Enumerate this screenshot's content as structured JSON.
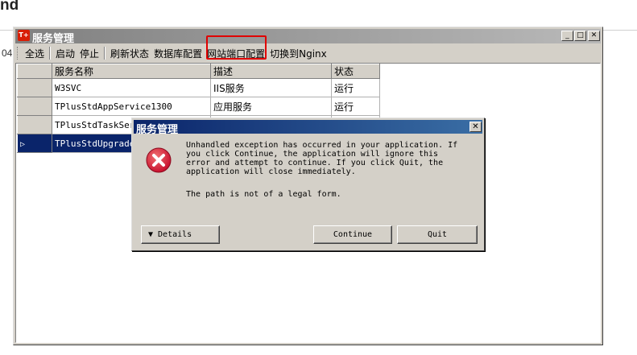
{
  "background": {
    "title": "nd",
    "side_label": "04"
  },
  "window": {
    "title": "服务管理",
    "icon_text": "T+",
    "controls": {
      "minimize": "_",
      "maximize": "□",
      "close": "✕"
    }
  },
  "toolbar": {
    "items": [
      "全选",
      "启动",
      "停止",
      "刷新状态",
      "数据库配置",
      "网站端口配置",
      "切换到Nginx"
    ]
  },
  "grid": {
    "headers": [
      "服务名称",
      "描述",
      "状态"
    ],
    "rows": [
      {
        "name": "W3SVC",
        "desc": "IIS服务",
        "status": "运行"
      },
      {
        "name": "TPlusStdAppService1300",
        "desc": "应用服务",
        "status": "运行"
      },
      {
        "name": "TPlusStdTaskServi",
        "desc": "",
        "status": ""
      },
      {
        "name": "TPlusStdUpgradeSe",
        "desc": "",
        "status": ""
      }
    ],
    "selected_row_marker": "▷"
  },
  "dialog": {
    "title": "服务管理",
    "close": "✕",
    "message": "Unhandled exception has occurred in your application. If\nyou click Continue, the application will ignore this\nerror and attempt to continue. If you click Quit, the\napplication will close immediately.",
    "detail": "The path is not of a legal form.",
    "buttons": {
      "details": "▼  Details",
      "continue": "Continue",
      "quit": "Quit"
    }
  },
  "colors": {
    "highlight": "#e00000",
    "selection": "#0a246a",
    "error": "#c8102e"
  }
}
